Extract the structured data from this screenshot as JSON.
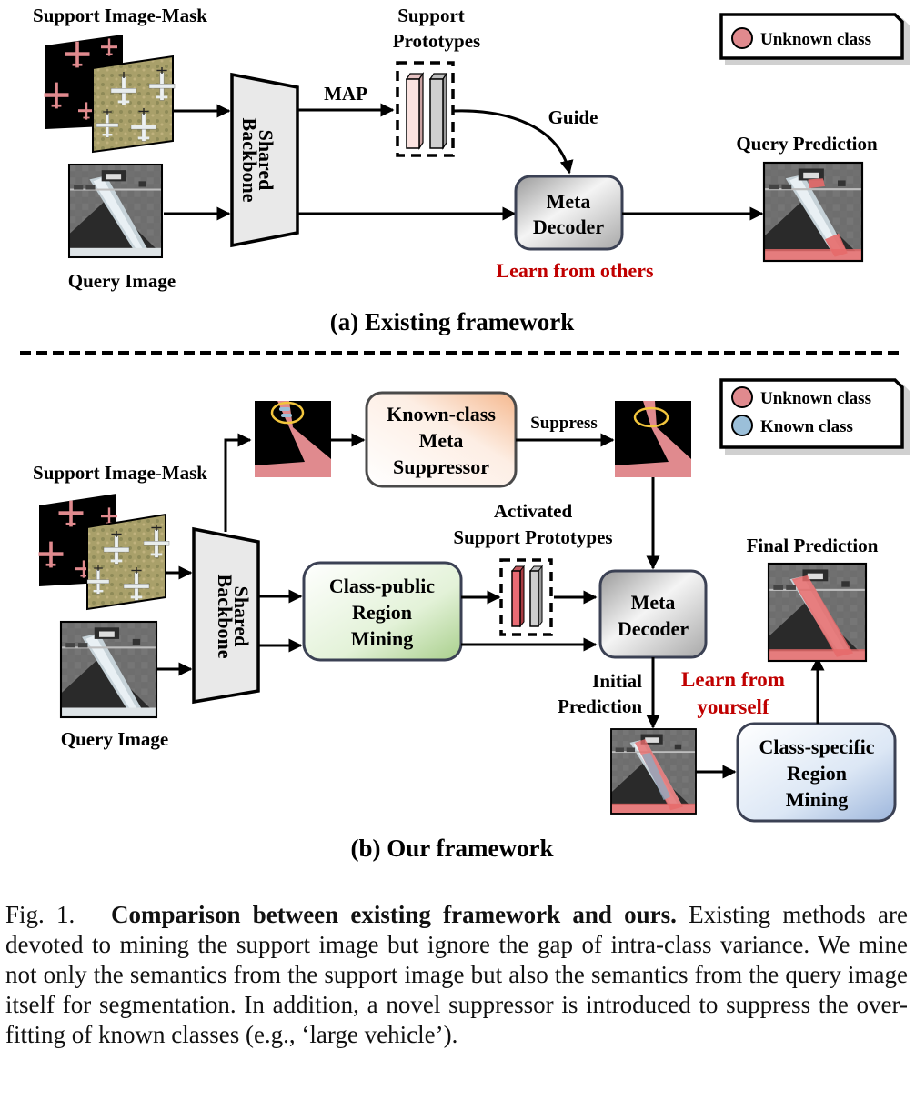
{
  "part_a": {
    "support_image_mask_label": "Support Image-Mask",
    "query_image_label": "Query Image",
    "backbone_label_line1": "Shared",
    "backbone_label_line2": "Backbone",
    "map_label": "MAP",
    "support_prototypes_line1": "Support",
    "support_prototypes_line2": "Prototypes",
    "guide_label": "Guide",
    "meta_decoder_line1": "Meta",
    "meta_decoder_line2": "Decoder",
    "learn_label": "Learn from others",
    "query_prediction_label": "Query Prediction",
    "legend": [
      {
        "label": "Unknown class",
        "color": "#e08a8e"
      }
    ],
    "title": "(a) Existing framework"
  },
  "part_b": {
    "support_image_mask_label": "Support Image-Mask",
    "query_image_label": "Query Image",
    "backbone_label_line1": "Shared",
    "backbone_label_line2": "Backbone",
    "suppressor_line1": "Known-class",
    "suppressor_line2": "Meta",
    "suppressor_line3": "Suppressor",
    "suppress_label": "Suppress",
    "class_public_line1": "Class-public",
    "class_public_line2": "Region",
    "class_public_line3": "Mining",
    "activated_line1": "Activated",
    "activated_line2": "Support Prototypes",
    "meta_decoder_line1": "Meta",
    "meta_decoder_line2": "Decoder",
    "initial_prediction_line1": "Initial",
    "initial_prediction_line2": "Prediction",
    "learn_line1": "Learn from",
    "learn_line2": "yourself",
    "final_prediction_label": "Final Prediction",
    "class_specific_line1": "Class-specific",
    "class_specific_line2": "Region",
    "class_specific_line3": "Mining",
    "legend": [
      {
        "label": "Unknown class",
        "color": "#e08a8e"
      },
      {
        "label": "Known class",
        "color": "#9bbfd9"
      }
    ],
    "title": "(b) Our framework"
  },
  "colors": {
    "accent_red": "#c00000",
    "unknown_class": "#e08a8e",
    "known_class": "#9bbfd9",
    "highlight_ring": "#f2c53d"
  },
  "caption": {
    "fig_label": "Fig. 1.",
    "bold_title": "Comparison between existing framework and ours.",
    "body": "Existing methods are devoted to mining the support image but ignore the gap of intra-class variance. We mine not only the semantics from the support image but also the semantics from the query image itself for segmentation. In addition, a novel suppressor is introduced to suppress the over-fitting of known classes (e.g., ‘large vehicle’)."
  }
}
